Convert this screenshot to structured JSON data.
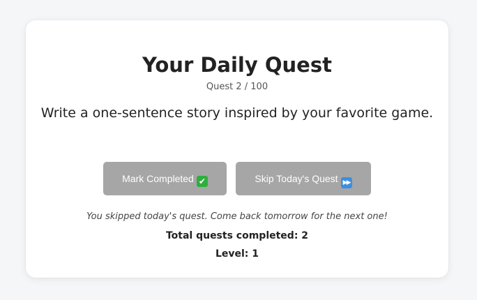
{
  "quest": {
    "title": "Your Daily Quest",
    "counter": "Quest 2 / 100",
    "prompt": "Write a one-sentence story inspired by your favorite game."
  },
  "buttons": {
    "complete_label": "Mark Completed",
    "complete_icon": "check-mark-emoji-icon",
    "complete_glyph": "✔",
    "skip_label": "Skip Today's Quest",
    "skip_icon": "fast-forward-emoji-icon",
    "skip_glyph": "▶▶",
    "background_color": "#a6a6a6"
  },
  "status": {
    "message": "You skipped today's quest. Come back tomorrow for the next one!",
    "total_completed": "Total quests completed: 2",
    "level": "Level: 1"
  }
}
